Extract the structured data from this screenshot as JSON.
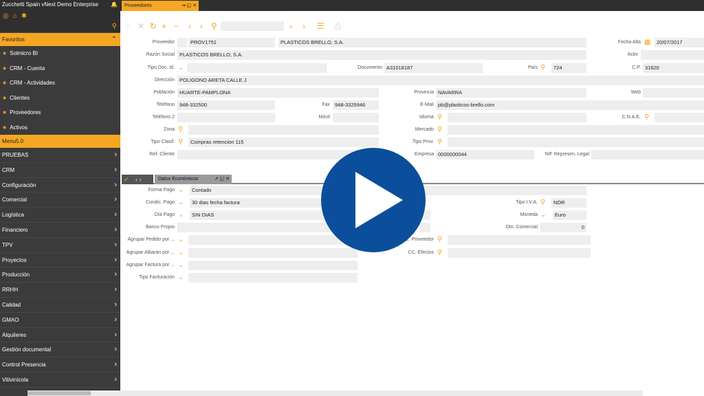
{
  "app": {
    "title": "Zucchetti Spain vNext Demo Enterprise"
  },
  "sidebar": {
    "favorites_label": "Favoritos",
    "favorites": [
      "Solmicro BI",
      "CRM - Cuenta",
      "CRM - Actividades",
      "Clientes",
      "Proveedores",
      "Activos"
    ],
    "menu_label": "Menu5.0",
    "menu": [
      "PRUEBAS",
      "CRM",
      "Configuración",
      "Comercial",
      "Logística",
      "Financiero",
      "TPV",
      "Proyectos",
      "Producción",
      "RRHH",
      "Calidad",
      "GMAO",
      "Alquileres",
      "Gestión documental",
      "Control Presencia",
      "Vitivinícola"
    ]
  },
  "tab": {
    "label": "Proveedores"
  },
  "form": {
    "proveedor_label": "Proveedor",
    "proveedor_code": "PROV1751",
    "proveedor_name": "PLASTICOS BRELLO, S.A.",
    "fecha_alta_label": "Fecha Alta",
    "fecha_alta": "20/07/2017",
    "razon_label": "Razón Social",
    "razon": "PLASTICOS BRELLO, S.A.",
    "activo_label": "Activ",
    "tipo_doc_label": "Tipo Doc. Id.",
    "documento_label": "Documento",
    "documento": "A31018187",
    "pais_label": "País",
    "pais": "724",
    "cp_label": "C.P.",
    "cp": "31620",
    "direccion_label": "Dirección",
    "direccion": "POLIGONO ARETA CALLE J",
    "poblacion_label": "Población",
    "poblacion": "HUARTE-PAMPLONA",
    "provincia_label": "Provincia",
    "provincia": "NAVARRA",
    "web_label": "Web",
    "telefono_label": "Teléfono",
    "telefono": "948-332500",
    "fax_label": "Fax",
    "fax": "948-3325946",
    "email_label": "E-Mail",
    "email": "pb@plasticos-brello.com",
    "telefono2_label": "Teléfono 2",
    "movil_label": "Móvil",
    "idioma_label": "Idioma",
    "cnae_label": "C.N.A.E.",
    "zona_label": "Zona",
    "mercado_label": "Mercado",
    "tipo_clasif_label": "Tipo Clasif.",
    "tipo_clasif": "Compras retencion 115",
    "tipo_prov_label": "Tipo Prov.",
    "ref_cliente_label": "Ref. Cliente",
    "empresa_label": "Empresa",
    "empresa": "0000000044",
    "nif_label": "NIF Represen. Legal"
  },
  "subtab": {
    "label": "Datos Económicos"
  },
  "econ": {
    "forma_pago_label": "Forma Pago",
    "forma_pago": "Contado",
    "condic_pago_label": "Condic. Pago",
    "condic_pago": "30 dias fecha factura",
    "dia_pago_label": "Día Pago",
    "dia_pago": "SIN DIAS",
    "banco_label": "Banco Propio",
    "agrupar_pedido_label": "Agrupar Pedido por ...",
    "agrupar_albaran_label": "Agrupar Albarán por ...",
    "agrupar_factura_label": "Agrupar Factura por ...",
    "tipo_fact_label": "Tipo Facturación",
    "tipo_iva_label": "Tipo I.V.A.",
    "tipo_iva": "NOR",
    "moneda_label": "Moneda",
    "moneda": "Euro",
    "dto_label": "Dto. Comercial",
    "dto": "0",
    "cc_prov_label": "C. Proveedor",
    "cc_efectos_label": "CC. Efectos"
  }
}
